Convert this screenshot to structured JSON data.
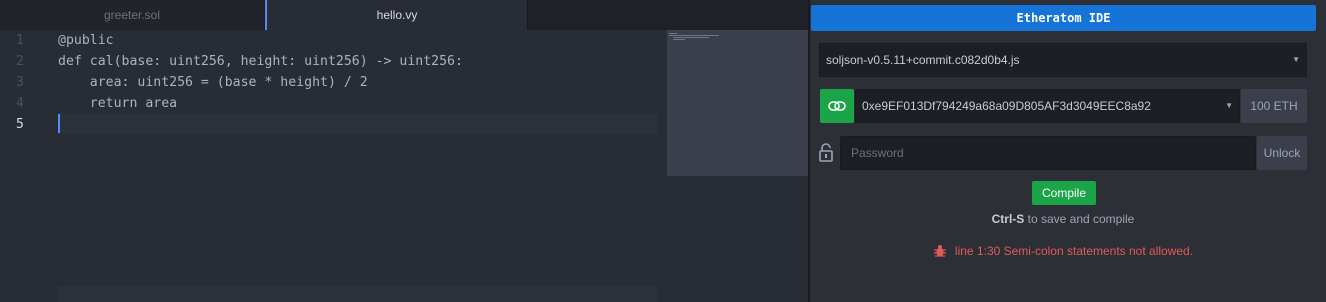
{
  "tabs": [
    {
      "label": "greeter.sol",
      "active": false
    },
    {
      "label": "hello.vy",
      "active": true
    }
  ],
  "editor": {
    "line_numbers": [
      "1",
      "2",
      "3",
      "4",
      "5"
    ],
    "lines": [
      "@public",
      "def cal(base: uint256, height: uint256) -> uint256:",
      "    area: uint256 = (base * height) / 2",
      "    return area",
      ""
    ],
    "active_line": 5
  },
  "panel": {
    "title": "Etheratom IDE",
    "compiler": "soljson-v0.5.11+commit.c082d0b4.js",
    "account": "0xe9EF013Df794249a68a09D805AF3d3049EEC8a92",
    "balance": "100 ETH",
    "password_placeholder": "Password",
    "unlock_label": "Unlock",
    "compile_label": "Compile",
    "hint_key": "Ctrl-S",
    "hint_text": " to save and compile",
    "error": "line 1:30 Semi-colon statements not allowed."
  },
  "colors": {
    "accent": "#1673d8",
    "green": "#1ba448",
    "error": "#e35b58"
  }
}
